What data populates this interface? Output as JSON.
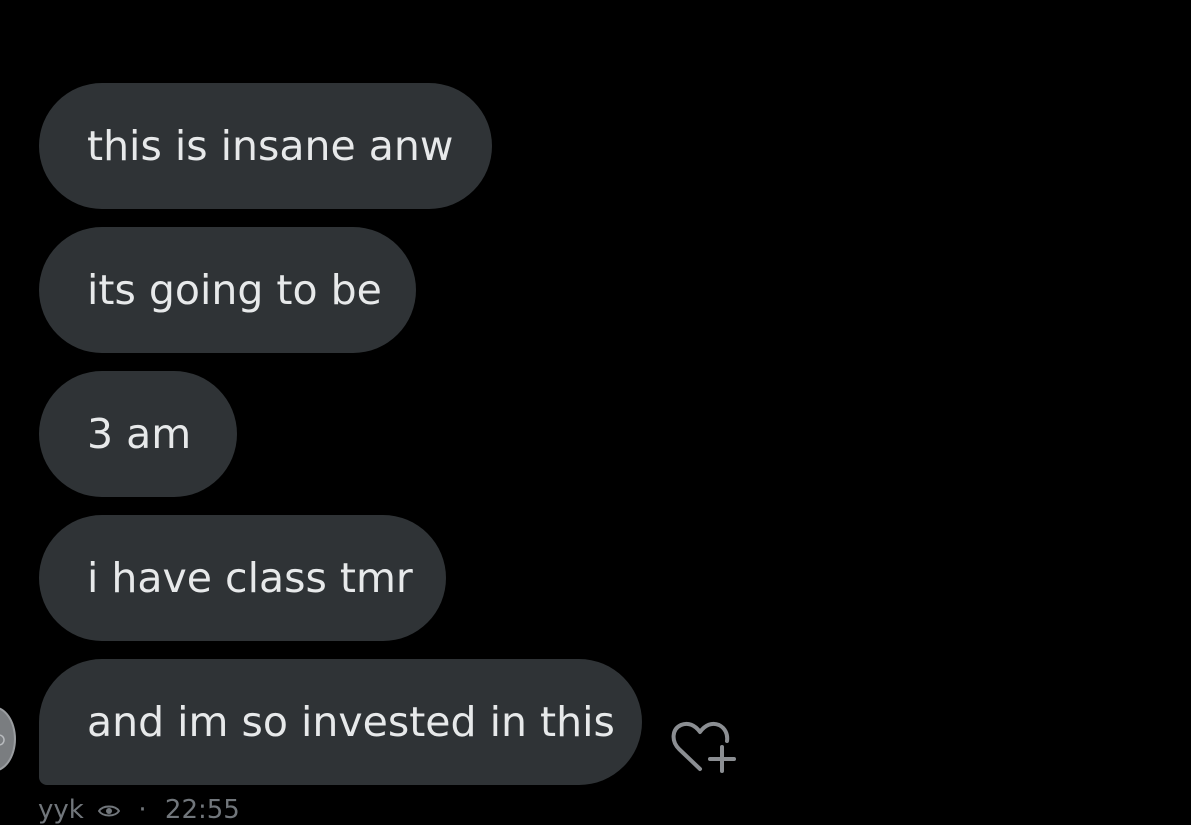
{
  "conversation": {
    "messages": [
      {
        "text": "this is insane anw"
      },
      {
        "text": "its going to be"
      },
      {
        "text": "3 am"
      },
      {
        "text": "i have class tmr"
      },
      {
        "text": "and im so invested in this"
      }
    ],
    "sender_label": "yyk",
    "timestamp": "22:55"
  },
  "theme": {
    "background": "#000000",
    "bubble": "#2f3336",
    "text": "#e7e9ea",
    "muted": "#71767b"
  },
  "icons": {
    "react": "heart-plus-icon",
    "seen": "eye-icon"
  }
}
